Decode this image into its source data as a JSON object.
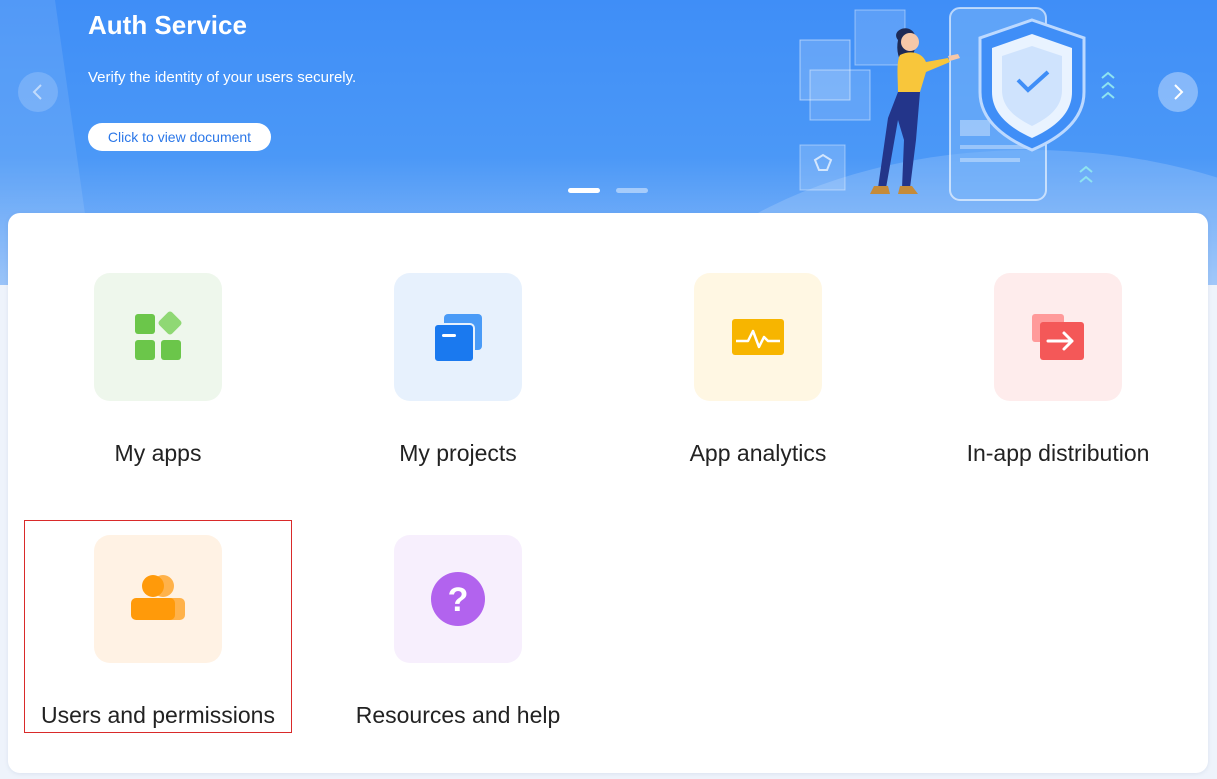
{
  "banner": {
    "title": "Auth Service",
    "subtitle": "Verify the identity of your users securely.",
    "document_button": "Click to view document",
    "prev_icon": "chevron-left-icon",
    "next_icon": "chevron-right-icon",
    "slides_total": 2,
    "active_slide": 1
  },
  "tiles": [
    {
      "label": "My apps",
      "icon": "apps-grid-icon",
      "bg": "#eef7ec",
      "color": "#6bc64a"
    },
    {
      "label": "My projects",
      "icon": "projects-stack-icon",
      "bg": "#e7f1fd",
      "color": "#1a79ef"
    },
    {
      "label": "App analytics",
      "icon": "analytics-pulse-icon",
      "bg": "#fff7e3",
      "color": "#f7b500"
    },
    {
      "label": "In-app distribution",
      "icon": "distribution-arrow-icon",
      "bg": "#feecec",
      "color": "#f45858"
    },
    {
      "label": "Users and permissions",
      "icon": "users-icon",
      "bg": "#fff2e4",
      "color": "#ff9a0a"
    },
    {
      "label": "Resources and help",
      "icon": "help-question-icon",
      "bg": "#f7effd",
      "color": "#b263ee"
    }
  ],
  "highlight_color": "#d92a2a"
}
